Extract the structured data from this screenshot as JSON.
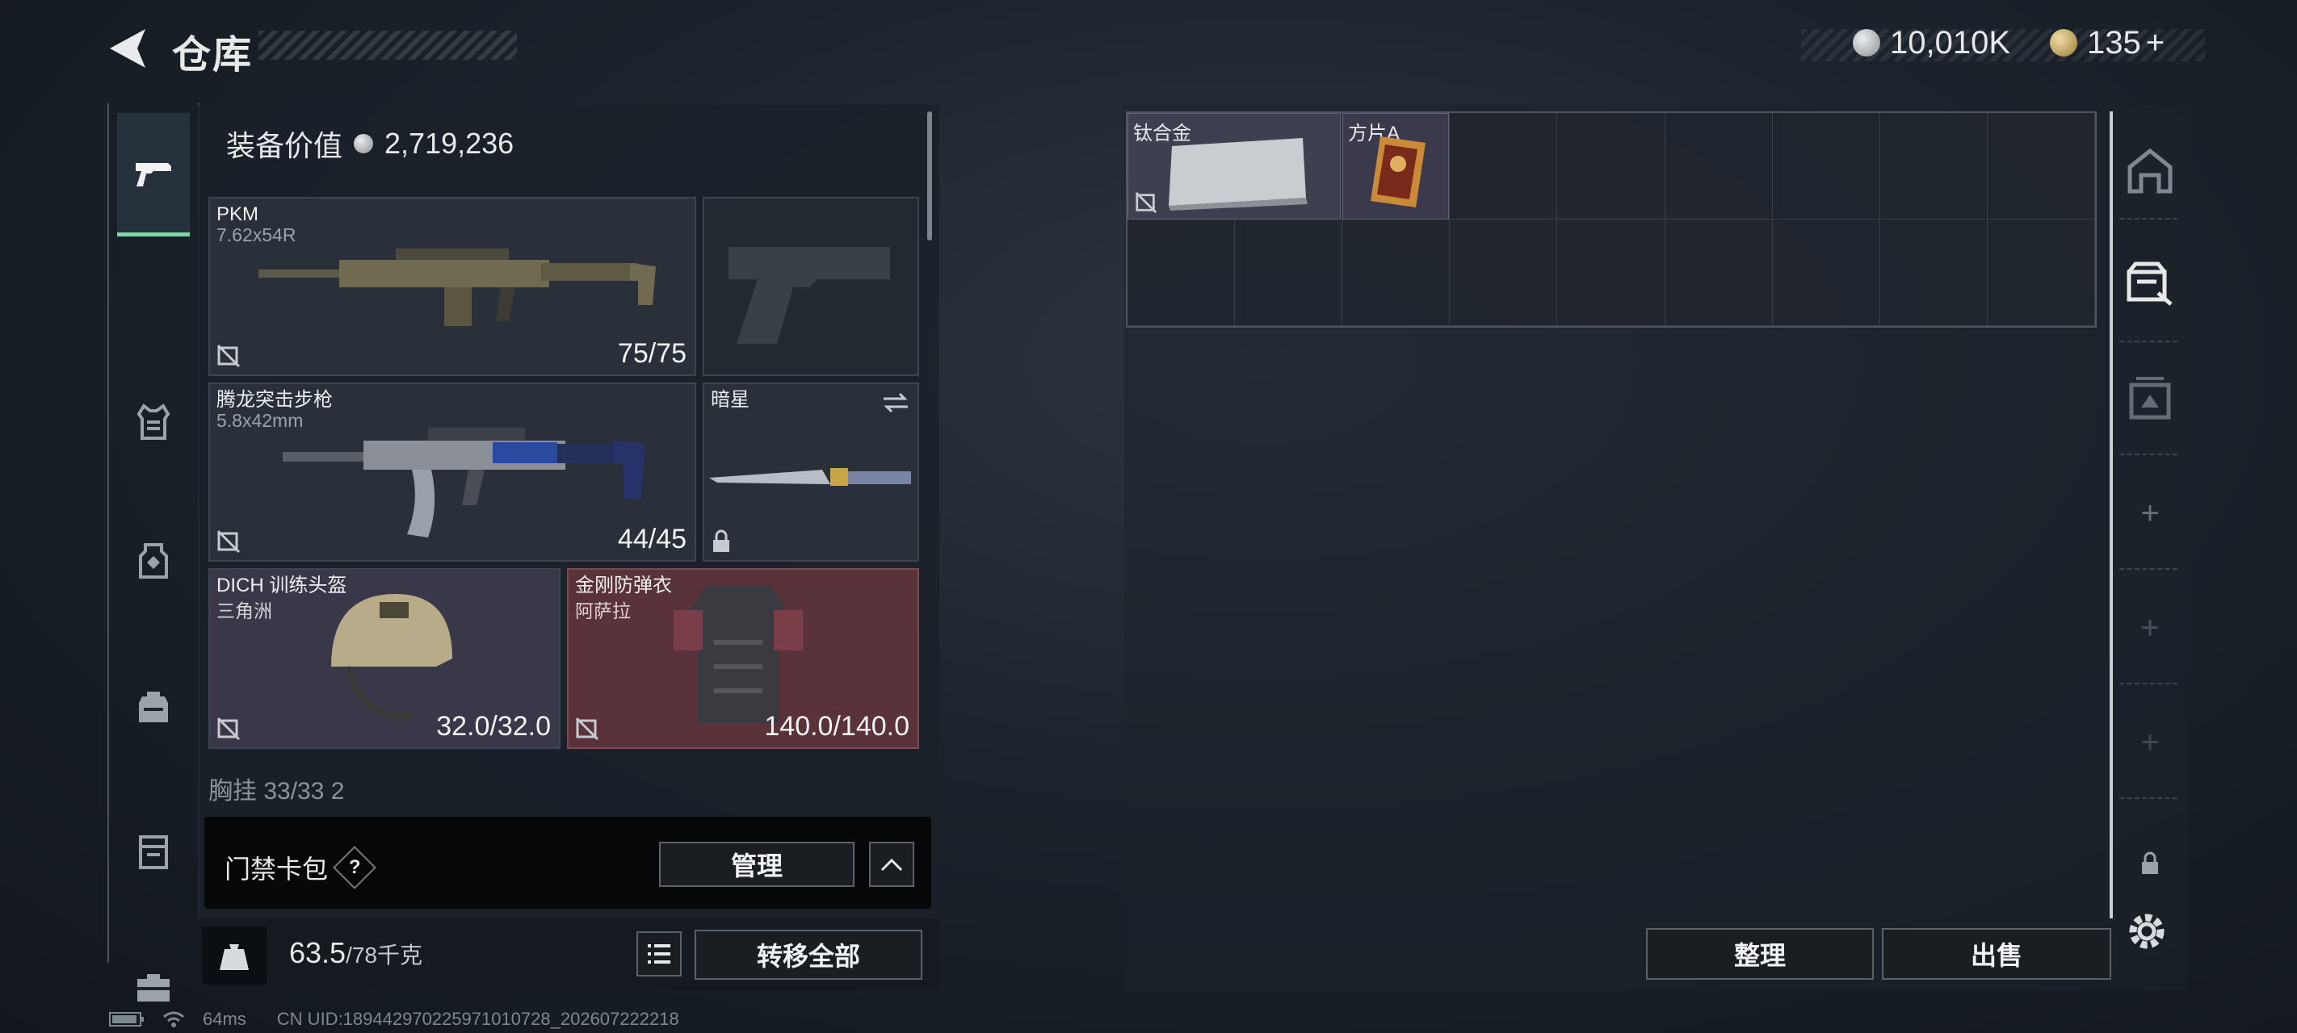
{
  "header": {
    "title": "仓库",
    "currency_1": "10,010K",
    "currency_2": "135",
    "currency_2_add": "+",
    "coin_colors": {
      "silver": "#b9bcc0",
      "gold": "#c9a864"
    }
  },
  "tabs": [
    {
      "icon": "pistol-icon",
      "active": true
    },
    {
      "icon": "vest-icon"
    },
    {
      "icon": "chest-rig-icon"
    },
    {
      "icon": "backpack-icon"
    },
    {
      "icon": "case-icon"
    },
    {
      "icon": "toolbox-icon"
    }
  ],
  "equipment": {
    "value_label": "装备价值",
    "value": "2,719,236",
    "primary_1": {
      "name": "PKM",
      "caliber": "7.62x54R",
      "ammo": "75/75"
    },
    "primary_2": {
      "name": "腾龙突击步枪",
      "caliber": "5.8x42mm",
      "ammo": "44/45"
    },
    "melee": {
      "name": "暗星",
      "locked": true
    },
    "helmet": {
      "name": "DICH 训练头盔",
      "sub": "三角洲",
      "durability": "32.0/32.0"
    },
    "armor": {
      "name": "金刚防弹衣",
      "sub": "阿萨拉",
      "durability": "140.0/140.0",
      "color": "#5a3239"
    },
    "chest_rig_partial": "胸挂  33/33  2"
  },
  "keycard": {
    "label": "门禁卡包",
    "help": "?",
    "manage_label": "管理"
  },
  "weight": {
    "current": "63.5",
    "max": "/78千克",
    "transfer_all_label": "转移全部"
  },
  "storage": {
    "items": [
      {
        "name": "钛合金"
      },
      {
        "name": "方片A"
      }
    ],
    "sort_label": "整理",
    "sell_label": "出售"
  },
  "status": {
    "ping": "64ms",
    "uid": "CN UID:18944297022597101072​8_202607222218"
  }
}
